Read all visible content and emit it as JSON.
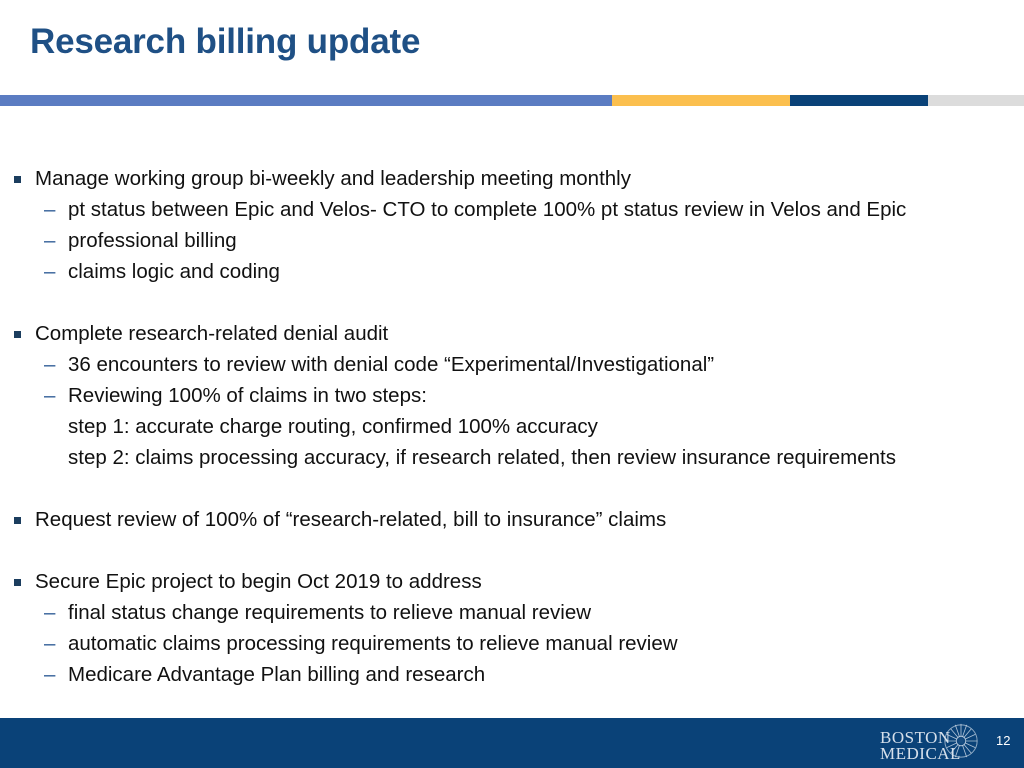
{
  "slide": {
    "title": "Research billing update",
    "accent_bar": {
      "segments": [
        {
          "name": "blue",
          "color": "#5b7cc2"
        },
        {
          "name": "yellow",
          "color": "#fbbf4e"
        },
        {
          "name": "navy",
          "color": "#0a4278"
        },
        {
          "name": "gray",
          "color": "#dcdcdc"
        }
      ]
    },
    "groups": [
      {
        "heading": "Manage working group bi-weekly and leadership meeting monthly",
        "sub": [
          "pt status between Epic and Velos- CTO to complete 100% pt status review in Velos and Epic",
          "professional billing",
          "claims logic and coding"
        ],
        "plain": []
      },
      {
        "heading": "Complete research-related denial audit",
        "sub": [
          "36 encounters to review with denial code “Experimental/Investigational”",
          "Reviewing 100% of claims in two steps:"
        ],
        "plain": [
          "step 1: accurate charge routing, confirmed 100% accuracy",
          "step 2: claims processing accuracy, if research related, then review insurance requirements"
        ]
      },
      {
        "heading": "Request review of 100% of “research-related, bill to insurance” claims",
        "sub": [],
        "plain": []
      },
      {
        "heading": "Secure Epic project to begin Oct 2019 to address",
        "sub": [
          "final status change requirements to relieve manual review",
          "automatic claims processing requirements  to relieve manual review",
          "Medicare Advantage Plan billing and research"
        ],
        "plain": []
      }
    ],
    "sub_bullet_marker": "–",
    "footer": {
      "logo_line1": "BOSTON",
      "logo_line2": "MEDICAL",
      "logo_emblem": "starburst-icon",
      "page_number": "12",
      "background_color": "#0a4278"
    },
    "colors": {
      "title": "#1f5085",
      "body_text": "#111111",
      "bullet_marker": "#1b3d5e",
      "sub_marker": "#2f5c96"
    }
  }
}
